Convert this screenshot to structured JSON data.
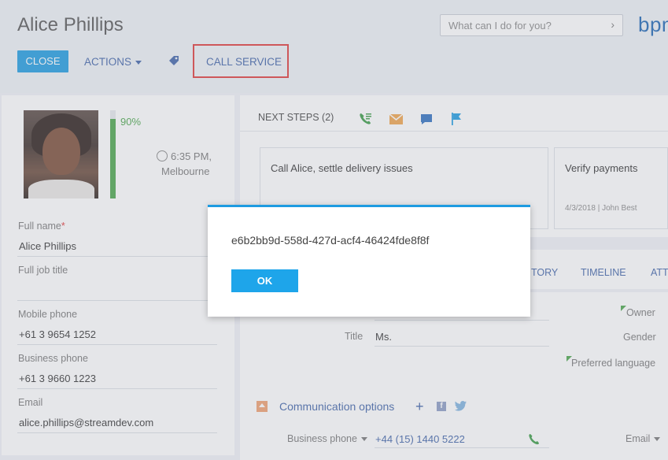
{
  "header": {
    "title": "Alice Phillips",
    "search_placeholder": "What can I do for you?",
    "logo_text": "bpm",
    "close_label": "CLOSE",
    "actions_label": "ACTIONS",
    "call_service_label": "CALL SERVICE"
  },
  "profile": {
    "completeness_text": "90%",
    "completeness_value": 0.9,
    "local_time": "6:35 PM,",
    "city": "Melbourne",
    "fields": [
      {
        "label": "Full name",
        "value": "Alice Phillips",
        "required": "*"
      },
      {
        "label": "Full job title",
        "value": ""
      },
      {
        "label": "Mobile phone",
        "value": "+61 3 9654 1252"
      },
      {
        "label": "Business phone",
        "value": "+61 3 9660 1223"
      },
      {
        "label": "Email",
        "value": "alice.phillips@streamdev.com"
      }
    ]
  },
  "next_steps": {
    "tab_label": "NEXT STEPS (2)",
    "cards": [
      {
        "title": "Call Alice, settle delivery issues",
        "meta": ""
      },
      {
        "title": "Verify payments",
        "meta": "4/3/2018 | John Best"
      }
    ]
  },
  "detail_tabs": [
    "TORY",
    "TIMELINE",
    "ATT"
  ],
  "details": {
    "title_label": "Title",
    "title_value": "Ms.",
    "owner_label": "Owner",
    "gender_label": "Gender",
    "preferred_language_label": "Preferred language",
    "communication_options_label": "Communication options",
    "business_phone_label": "Business phone",
    "business_phone_value": "+44 (15) 1440 5222",
    "email_label": "Email"
  },
  "dialog": {
    "message": "e6b2bb9d-558d-427d-acf4-46424fde8f8f",
    "ok_label": "OK"
  },
  "colors": {
    "accent": "#1e9be1",
    "link": "#3f63a8",
    "highlight_border": "#e03a3a",
    "progress": "#4aa54a"
  }
}
